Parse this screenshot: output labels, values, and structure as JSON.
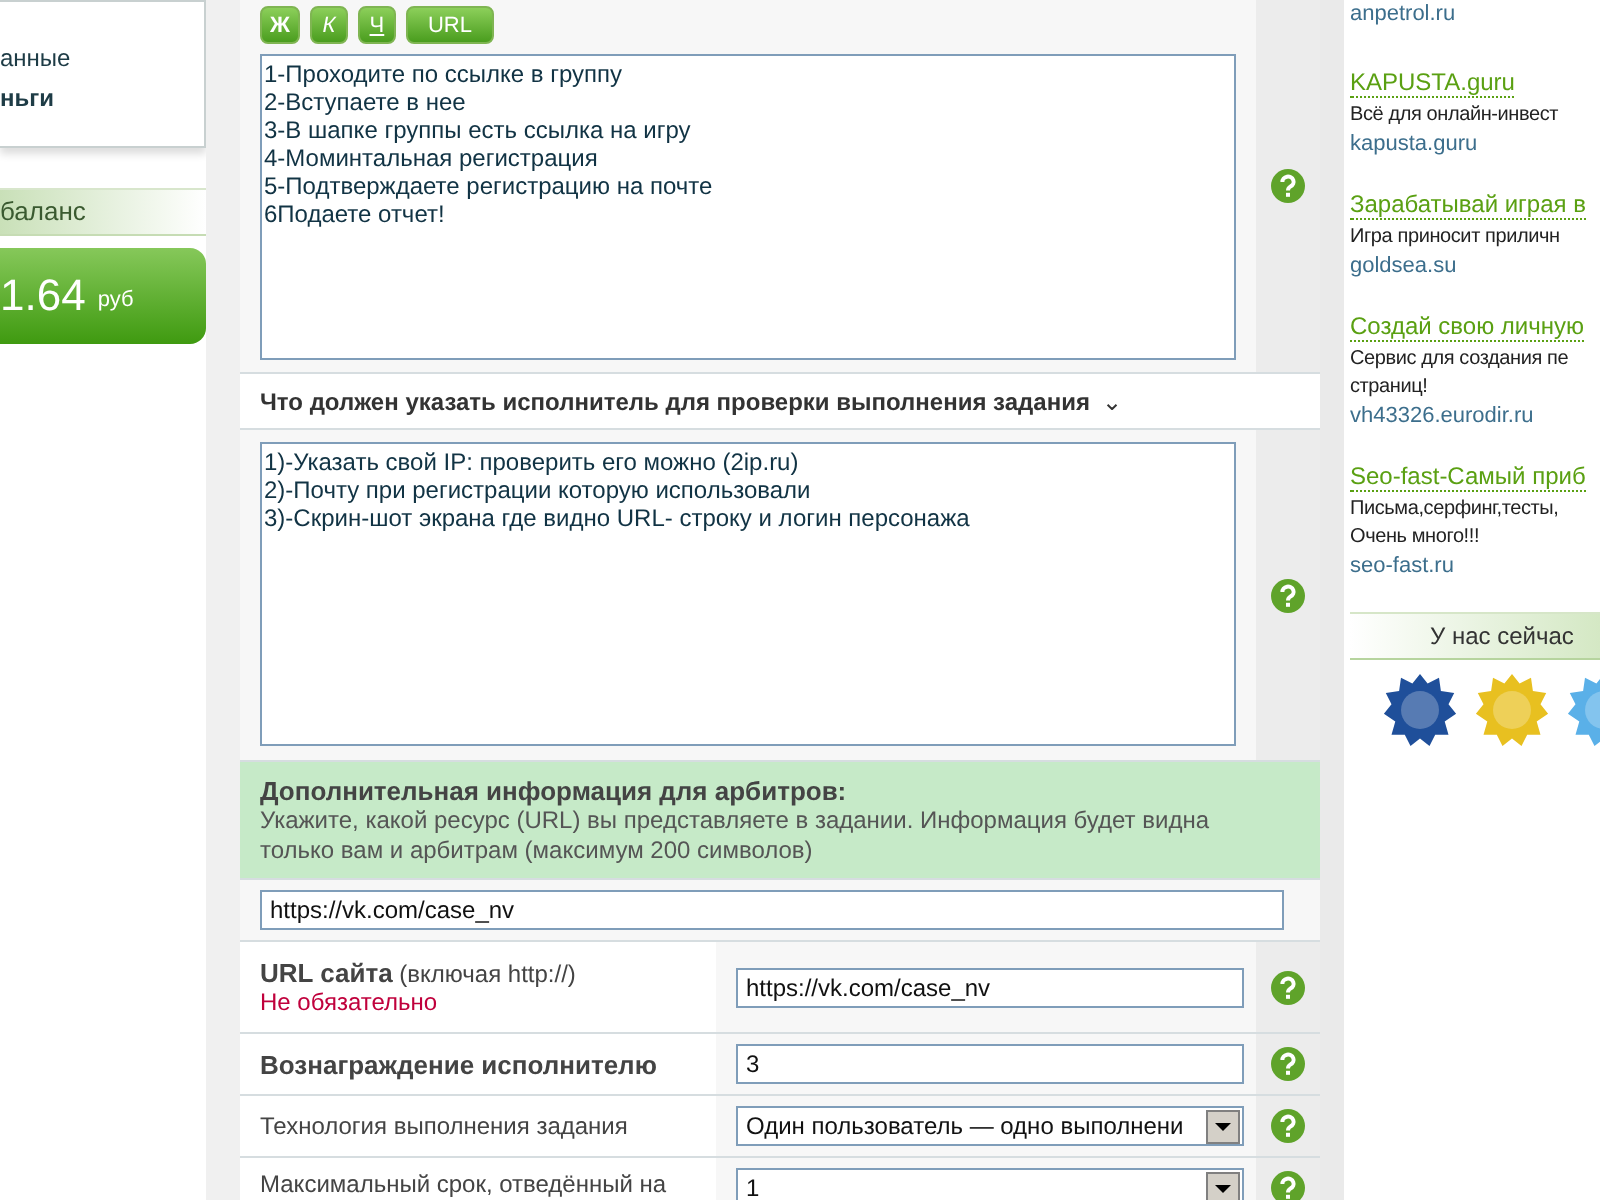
{
  "left_menu": {
    "items": [
      {
        "label": "анные",
        "selected": false
      },
      {
        "label": "ньги",
        "selected": true
      }
    ]
  },
  "balance": {
    "title": "баланс",
    "amount": "1.64",
    "currency": "руб"
  },
  "editor": {
    "buttons": [
      {
        "label": "Ж",
        "kind": "bold"
      },
      {
        "label": "К",
        "kind": "italic"
      },
      {
        "label": "Ч",
        "kind": "underline"
      },
      {
        "label": "URL",
        "kind": "link"
      }
    ],
    "text": "1-Проходите по ссылке в группу\n2-Вступаете в нее\n3-В шапке группы есть ссылка на игру\n4-Моминтальная регистрация\n5-Подтверждаете регистрацию на почте\n6Подаете отчет!"
  },
  "report": {
    "title": "Что должен указать исполнитель для проверки выполнения задания",
    "caret": "⌄",
    "text": "1)-Указать свой IP: проверить его можно (2ip.ru)\n2)-Почту при регистрации которую использовали\n3)-Скрин-шот экрана где видно URL- строку и логин персонажа"
  },
  "arbiter_info": {
    "title": "Дополнительная информация для арбитров:",
    "text": "Укажите, какой ресурс (URL) вы представляете в задании. Информация будет видна только вам и арбитрам (максимум 200 символов)",
    "value": "https://vk.com/case_nv"
  },
  "form_rows": [
    {
      "kind": "input",
      "label": "URL сайта",
      "hint": "(включая http://)",
      "note": "Не обязательно",
      "value": "https://vk.com/case_nv"
    },
    {
      "kind": "input",
      "label": "Вознаграждение исполнителю",
      "value": "3"
    },
    {
      "kind": "select",
      "label": "Технология выполнения задания",
      "value": "Один пользователь — одно выполнени"
    },
    {
      "kind": "select",
      "label": "Максимальный срок, отведённый на",
      "value": "1"
    }
  ],
  "ads": [
    {
      "url": "anpetrol.ru"
    },
    {
      "title": "KAPUSTA.guru",
      "text": "Всё для онлайн-инвест",
      "url": "kapusta.guru"
    },
    {
      "title": "Зарабатывай играя в",
      "text": "Игра приносит приличн",
      "url": "goldsea.su"
    },
    {
      "title": "Создай свою личную",
      "text": "Сервис для создания пе\nстраниц!",
      "url": "vh43326.eurodir.ru"
    },
    {
      "title": "Seo-fast-Самый приб",
      "text": "Письма,серфинг,тесты,\nОчень много!!!",
      "url": "seo-fast.ru"
    }
  ],
  "online": {
    "title": "У нас сейчас"
  }
}
